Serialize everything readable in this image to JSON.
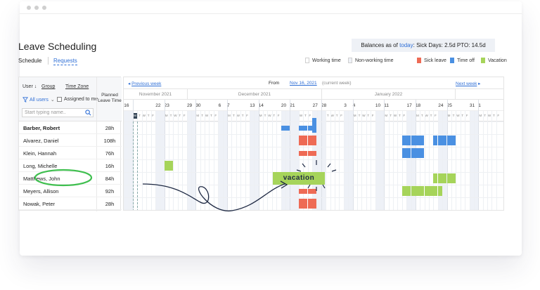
{
  "title": "Leave Scheduling",
  "tabs": {
    "schedule": "Schedule",
    "requests": "Requests"
  },
  "balances": {
    "prefix": "Balances as of",
    "link": "today",
    "suffix": ": Sick Days: 2.5d  PTO: 14.5d"
  },
  "legend": [
    {
      "label": "Working time",
      "color": "#ffffff"
    },
    {
      "label": "Non-working time",
      "color": "#eef1f7"
    },
    {
      "label": "Sick leave",
      "color": "#ee6b55"
    },
    {
      "label": "Time off",
      "color": "#4a90e2"
    },
    {
      "label": "Vacation",
      "color": "#a6d45a"
    }
  ],
  "filters": {
    "user_sort": "User ↓",
    "group": "Group",
    "time_zone": "Time Zone",
    "all_users": "All users",
    "assigned_to_me": "Assigned to me",
    "search_placeholder": "Start typing name..",
    "planned_header": "Planned Leave Time"
  },
  "users": [
    {
      "name": "Barber, Robert",
      "hours": "28h"
    },
    {
      "name": "Alvarez, Daniel",
      "hours": "108h"
    },
    {
      "name": "Klein, Hannah",
      "hours": "76h"
    },
    {
      "name": "Long, Michelle",
      "hours": "16h"
    },
    {
      "name": "Matthews, John",
      "hours": "84h"
    },
    {
      "name": "Meyers, Allison",
      "hours": "92h"
    },
    {
      "name": "Nowak, Peter",
      "hours": "28h"
    }
  ],
  "nav": {
    "prev_arrow": "◂",
    "prev_label": "Previous week",
    "from_label": "From",
    "from_date": "Nov 16, 2021",
    "current_week": "(current week)",
    "next_label": "Next week",
    "next_arrow": "▸"
  },
  "months": [
    "November 2021",
    "December 2021",
    "January 2022"
  ],
  "week_dates": [
    "16",
    "22",
    "23",
    "29",
    "30",
    "6",
    "7",
    "13",
    "14",
    "20",
    "21",
    "27",
    "28",
    "3",
    "4",
    "10",
    "11",
    "17",
    "18",
    "24",
    "25",
    "31",
    "1",
    "7"
  ],
  "day_initials": [
    "M",
    "T",
    "W",
    "T",
    "F",
    "S",
    "S"
  ],
  "annotation": "vacation"
}
